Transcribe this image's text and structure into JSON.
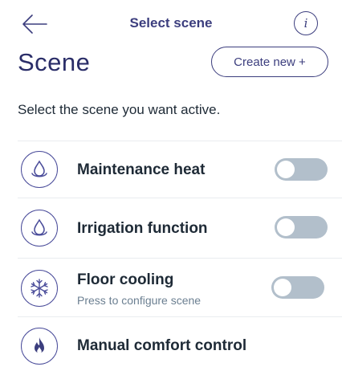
{
  "header": {
    "title": "Select scene",
    "back_icon": "arrow-left-icon",
    "info_icon": "info-icon"
  },
  "page": {
    "title": "Scene",
    "create_button_label": "Create new +",
    "subtitle": "Select the scene you want active."
  },
  "scenes": [
    {
      "label": "Maintenance heat",
      "sublabel": "",
      "icon": "water-drop-icon",
      "toggle_on": false
    },
    {
      "label": "Irrigation function",
      "sublabel": "",
      "icon": "water-drop-icon",
      "toggle_on": false
    },
    {
      "label": "Floor cooling",
      "sublabel": "Press to configure scene",
      "icon": "snowflake-icon",
      "toggle_on": false
    },
    {
      "label": "Manual comfort control",
      "sublabel": "",
      "icon": "flame-icon",
      "toggle_on": null
    }
  ],
  "colors": {
    "accent": "#3c3e7e",
    "text": "#1e2a36",
    "muted": "#6b7f91",
    "toggle_off": "#b2bfcb",
    "divider": "#e9ecef"
  }
}
